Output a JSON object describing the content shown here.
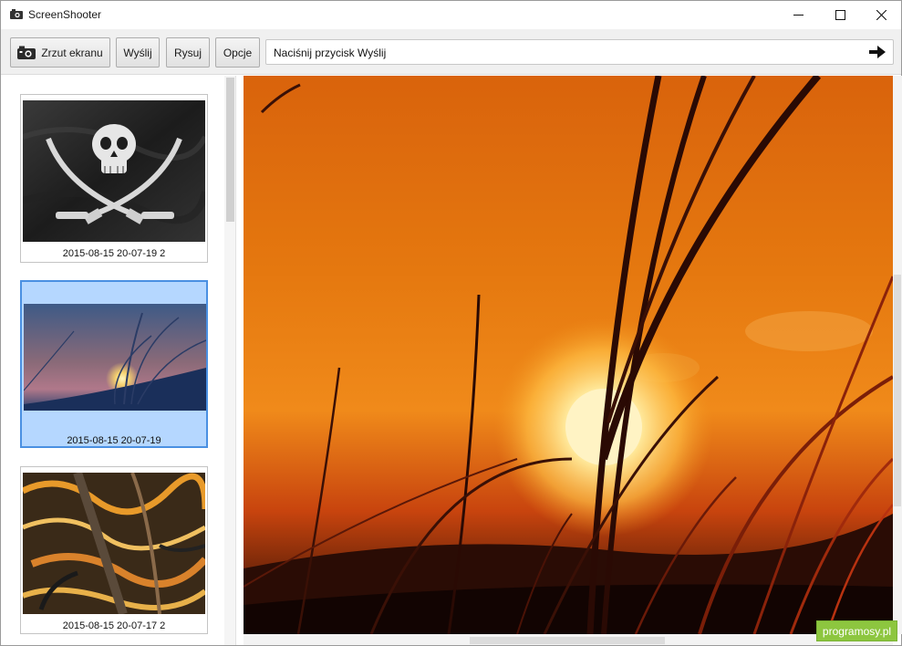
{
  "window": {
    "title": "ScreenShooter",
    "icons": [
      "camera-icon",
      "minimize-icon",
      "maximize-icon",
      "close-icon"
    ]
  },
  "toolbar": {
    "screenshot_label": "Zrzut ekranu",
    "send_label": "Wyślij",
    "draw_label": "Rysuj",
    "options_label": "Opcje",
    "status_text": "Naciśnij przycisk Wyślij",
    "status_icon": "arrow-right-icon"
  },
  "thumbnails": [
    {
      "caption": "2015-08-15 20-07-19 2",
      "image": "pirate-flag",
      "selected": false
    },
    {
      "caption": "2015-08-15 20-07-19",
      "image": "sunset-grass",
      "selected": true
    },
    {
      "caption": "2015-08-15 20-07-17 2",
      "image": "abstract-painting",
      "selected": false
    }
  ],
  "preview": {
    "image": "sunset-grass-large"
  },
  "watermark": {
    "text": "programosy.pl",
    "color": "#8dc63f"
  },
  "colors": {
    "selection": "#b5d7ff",
    "selection_border": "#4a90e2"
  }
}
